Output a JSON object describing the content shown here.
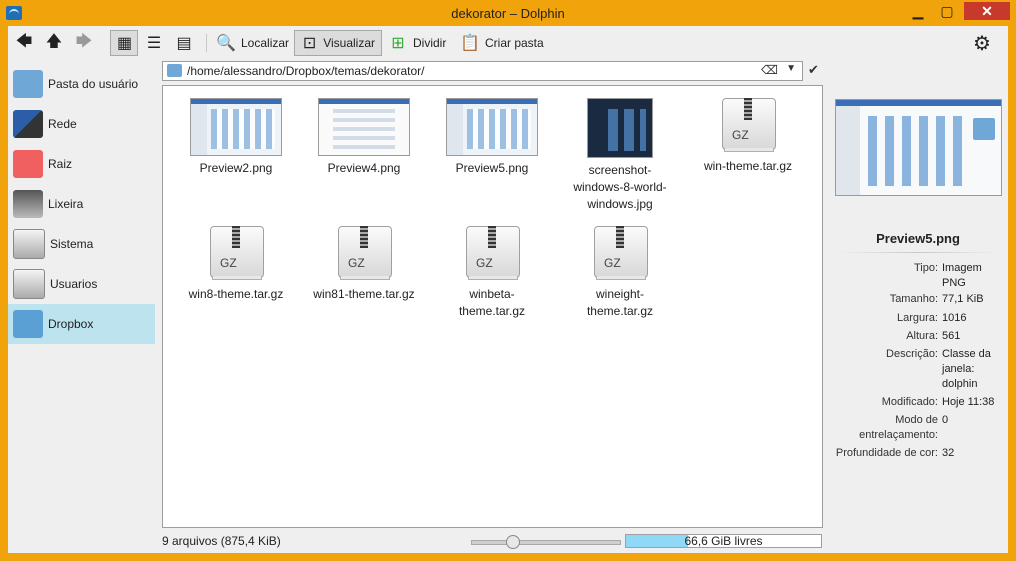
{
  "window": {
    "title": "dekorator – Dolphin",
    "accent": "#f0a30a",
    "close_label": "✕",
    "min_label": "▁",
    "max_label": "▢"
  },
  "toolbar": {
    "back": "back-arrow-icon",
    "up": "up-arrow-icon",
    "forward": "forward-arrow-icon",
    "find_label": "Localizar",
    "preview_label": "Visualizar",
    "split_label": "Dividir",
    "paste_label": "Criar pasta"
  },
  "sidebar": {
    "items": [
      {
        "label": "Pasta do usuário"
      },
      {
        "label": "Rede"
      },
      {
        "label": "Raiz"
      },
      {
        "label": "Lixeira"
      },
      {
        "label": "Sistema"
      },
      {
        "label": "Usuarios"
      },
      {
        "label": "Dropbox"
      }
    ]
  },
  "location": {
    "path": "/home/alessandro/Dropbox/temas/dekorator/"
  },
  "files": [
    {
      "name": "Preview2.png"
    },
    {
      "name": "Preview4.png"
    },
    {
      "name": "Preview5.png"
    },
    {
      "name": "screenshot-windows-8-world-windows.jpg"
    },
    {
      "name": "win-theme.tar.gz"
    },
    {
      "name": "win8-theme.tar.gz"
    },
    {
      "name": "win81-theme.tar.gz"
    },
    {
      "name": "winbeta-theme.tar.gz"
    },
    {
      "name": "wineight-theme.tar.gz"
    }
  ],
  "gz_label": "GZ",
  "status": {
    "summary": "9 arquivos (875,4 KiB)",
    "free_space": "66,6 GiB livres",
    "free_fraction": 0.32
  },
  "info": {
    "title": "Preview5.png",
    "rows": [
      {
        "k": "Tipo:",
        "v": "Imagem PNG"
      },
      {
        "k": "Tamanho:",
        "v": "77,1 KiB"
      },
      {
        "k": "Largura:",
        "v": "1016"
      },
      {
        "k": "Altura:",
        "v": "561"
      },
      {
        "k": "Descrição:",
        "v": "Classe da janela: dolphin"
      },
      {
        "k": "Modificado:",
        "v": "Hoje 11:38"
      },
      {
        "k": "Modo de entrelaçamento:",
        "v": "0"
      },
      {
        "k": "Profundidade de cor:",
        "v": "32"
      }
    ]
  }
}
